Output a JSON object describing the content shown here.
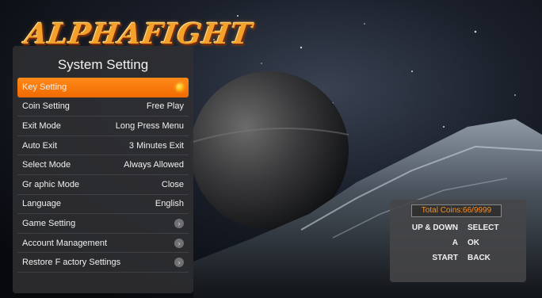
{
  "logo": {
    "text": "ALPHAFIGHT"
  },
  "panel": {
    "title": "System Setting",
    "items": [
      {
        "label": "Key Setting",
        "value": "",
        "indicator": "active-dot-icon",
        "selected": true
      },
      {
        "label": "Coin Setting",
        "value": "Free Play"
      },
      {
        "label": "Exit Mode",
        "value": "Long Press Menu"
      },
      {
        "label": "Auto Exit",
        "value": "3 Minutes Exit"
      },
      {
        "label": "Select Mode",
        "value": "Always Allowed"
      },
      {
        "label": "Gr aphic Mode",
        "value": "Close"
      },
      {
        "label": "Language",
        "value": "English"
      },
      {
        "label": "Game Setting",
        "value": "",
        "indicator": "chevron-right-icon"
      },
      {
        "label": "Account Management",
        "value": "",
        "indicator": "chevron-right-icon"
      },
      {
        "label": "Restore F actory Settings",
        "value": "",
        "indicator": "chevron-right-icon"
      }
    ]
  },
  "help": {
    "coins": "Total Coins:66/9999",
    "keys": [
      {
        "key": "UP & DOWN",
        "action": "SELECT"
      },
      {
        "key": "A",
        "action": "OK"
      },
      {
        "key": "START",
        "action": "BACK"
      }
    ]
  },
  "colors": {
    "accent": "#f47a0a",
    "coins_text": "#ff8c1a",
    "panel_bg": "#303032"
  }
}
